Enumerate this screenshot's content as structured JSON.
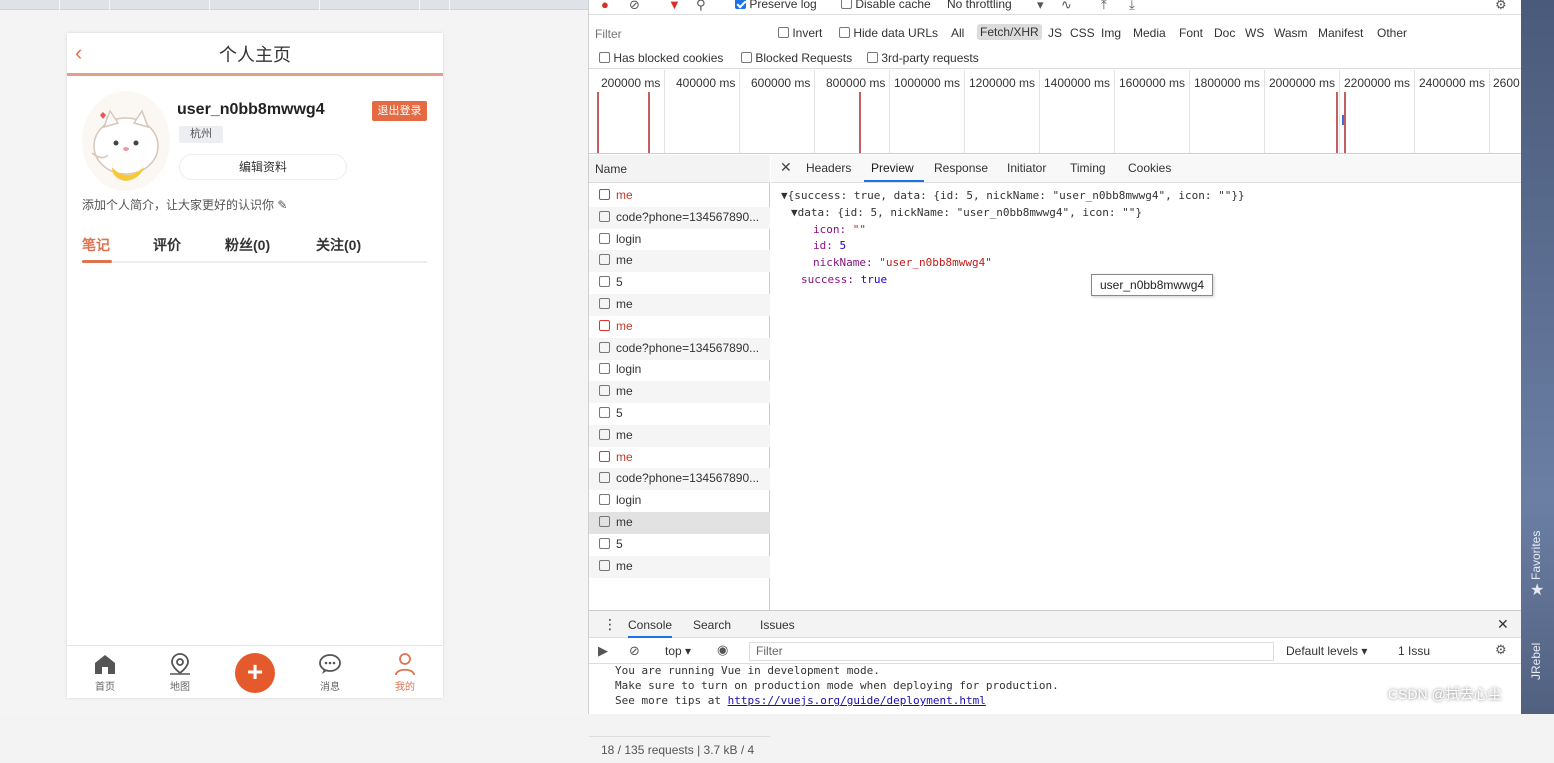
{
  "app": {
    "header_title": "个人主页",
    "username": "user_n0bb8mwwg4",
    "logout_label": "退出登录",
    "city": "杭州",
    "edit_label": "编辑资料",
    "intro": "添加个人简介，让大家更好的认识你 ✎",
    "tabs": [
      "笔记",
      "评价",
      "粉丝(0)",
      "关注(0)"
    ],
    "nav": {
      "home": "首页",
      "map": "地图",
      "add": "+",
      "message": "消息",
      "mine": "我的"
    },
    "accent_color": "#e0734f"
  },
  "devtools": {
    "toolbar": {
      "preserve_log": "Preserve log",
      "disable_cache": "Disable cache",
      "throttling": "No throttling"
    },
    "filter_placeholder": "Filter",
    "invert": "Invert",
    "hide_data_urls": "Hide data URLs",
    "type_filters": [
      "All",
      "Fetch/XHR",
      "JS",
      "CSS",
      "Img",
      "Media",
      "Font",
      "Doc",
      "WS",
      "Wasm",
      "Manifest",
      "Other"
    ],
    "blocked": {
      "has_blocked_cookies": "Has blocked cookies",
      "blocked_requests": "Blocked Requests",
      "third_party": "3rd-party requests"
    },
    "timeline_labels": [
      "200000 ms",
      "400000 ms",
      "600000 ms",
      "800000 ms",
      "1000000 ms",
      "1200000 ms",
      "1400000 ms",
      "1600000 ms",
      "1800000 ms",
      "2000000 ms",
      "2200000 ms",
      "2400000 ms",
      "2600"
    ],
    "name_header": "Name",
    "requests": [
      {
        "name": "me",
        "error": true
      },
      {
        "name": "code?phone=134567890...",
        "error": false
      },
      {
        "name": "login",
        "error": false
      },
      {
        "name": "me",
        "error": false
      },
      {
        "name": "5",
        "error": false
      },
      {
        "name": "me",
        "error": false
      },
      {
        "name": "me",
        "error": true
      },
      {
        "name": "code?phone=134567890...",
        "error": false
      },
      {
        "name": "login",
        "error": false
      },
      {
        "name": "me",
        "error": false
      },
      {
        "name": "5",
        "error": false
      },
      {
        "name": "me",
        "error": false
      },
      {
        "name": "me",
        "error": true
      },
      {
        "name": "code?phone=134567890...",
        "error": false
      },
      {
        "name": "login",
        "error": false
      },
      {
        "name": "me",
        "error": false
      },
      {
        "name": "5",
        "error": false
      },
      {
        "name": "me",
        "error": false
      }
    ],
    "status_bar": "18 / 135 requests | 3.7 kB / 4",
    "detail_tabs": [
      "Headers",
      "Preview",
      "Response",
      "Initiator",
      "Timing",
      "Cookies"
    ],
    "preview": {
      "line1": "▼{success: true, data: {id: 5, nickName: \"user_n0bb8mwwg4\", icon: \"\"}}",
      "line2": "▼data: {id: 5, nickName: \"user_n0bb8mwwg4\", icon: \"\"}",
      "icon_key": "icon:",
      "icon_val": "\"\"",
      "id_key": "id:",
      "id_val": "5",
      "nick_key": "nickName:",
      "nick_val": "\"user_n0bb8mwwg4\"",
      "success_key": "success:",
      "success_val": "true",
      "tooltip": "user_n0bb8mwwg4"
    },
    "console_tabs": [
      "Console",
      "Search",
      "Issues"
    ],
    "console_context": "top ▾",
    "console_filter": "Filter",
    "default_levels": "Default levels ▾",
    "issues_badge": "1 Issu",
    "console_lines": [
      "You are running Vue in development mode.",
      "Make sure to turn on production mode when deploying for production.",
      "See more tips at "
    ],
    "console_link": "https://vuejs.org/guide/deployment.html"
  },
  "side_rail": {
    "favorites": "Favorites",
    "jrebel": "JRebel"
  },
  "watermark": "CSDN @拭去心尘"
}
